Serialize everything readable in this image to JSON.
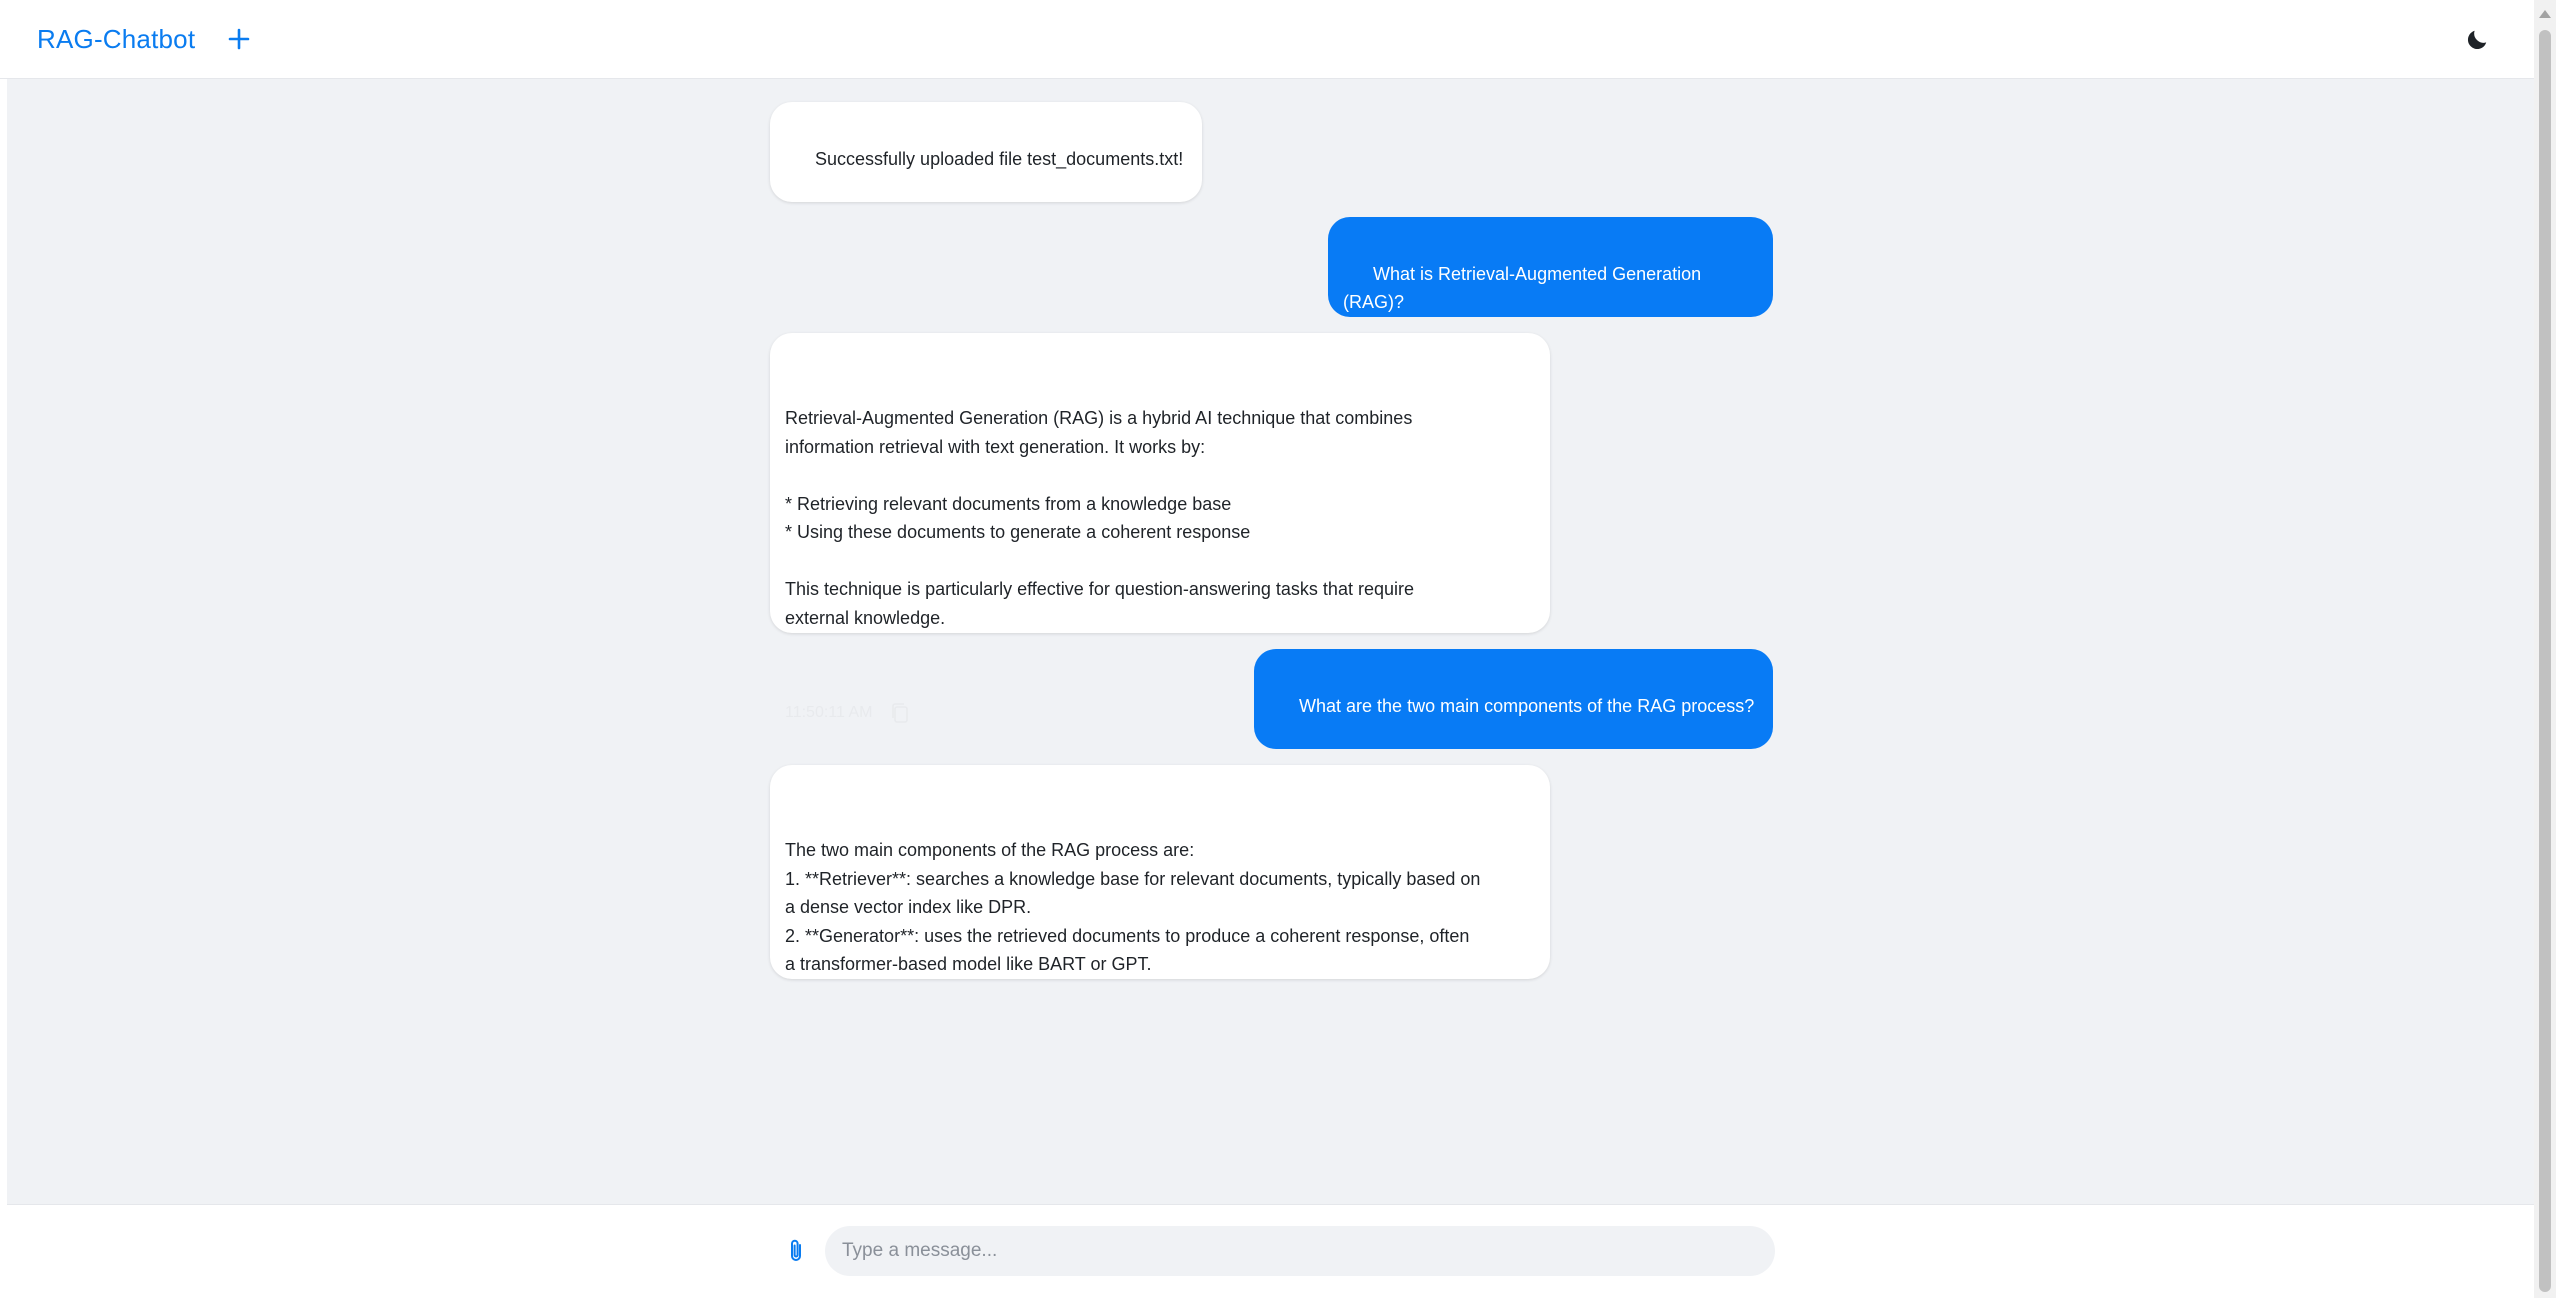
{
  "header": {
    "brand": "RAG-Chatbot",
    "new_chat_icon": "plus-icon",
    "theme_icon": "moon-icon"
  },
  "messages": [
    {
      "role": "bot",
      "text": "Successfully uploaded file test_documents.txt!"
    },
    {
      "role": "user",
      "text": "What is Retrieval-Augmented Generation (RAG)?"
    },
    {
      "role": "bot",
      "text": "Retrieval-Augmented Generation (RAG) is a hybrid AI technique that combines\ninformation retrieval with text generation. It works by:\n\n* Retrieving relevant documents from a knowledge base\n* Using these documents to generate a coherent response\n\nThis technique is particularly effective for question-answering tasks that require\nexternal knowledge.",
      "timestamp": "11:50:11 AM"
    },
    {
      "role": "user",
      "text": "What are the two main components of the RAG process?"
    },
    {
      "role": "bot",
      "text": "The two main components of the RAG process are:\n1. **Retriever**: searches a knowledge base for relevant documents, typically based on\na dense vector index like DPR.\n2. **Generator**: uses the retrieved documents to produce a coherent response, often\na transformer-based model like BART or GPT."
    }
  ],
  "input": {
    "placeholder": "Type a message...",
    "value": "",
    "attach_icon": "paperclip-icon"
  },
  "colors": {
    "accent": "#087bf5",
    "chat_background": "#f0f2f5",
    "bot_bubble": "#ffffff"
  }
}
